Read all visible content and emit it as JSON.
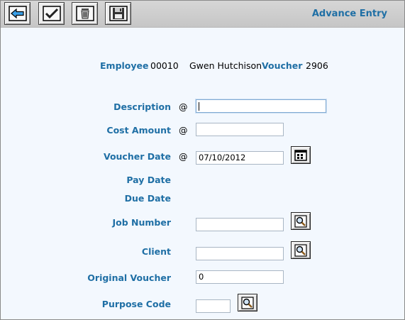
{
  "toolbar": {
    "back_icon": "back-arrow-icon",
    "confirm_icon": "checkmark-icon",
    "delete_icon": "trash-icon",
    "save_icon": "floppy-disk-icon"
  },
  "form_title": "Advance Entry",
  "employee": {
    "label": "Employee",
    "id": "00010",
    "name": "Gwen Hutchison"
  },
  "voucher": {
    "label": "Voucher",
    "number": "2906"
  },
  "required_marker": "@",
  "fields": {
    "description": {
      "label": "Description",
      "value": ""
    },
    "cost_amount": {
      "label": "Cost Amount",
      "value": ""
    },
    "voucher_date": {
      "label": "Voucher Date",
      "value": "07/10/2012"
    },
    "pay_date": {
      "label": "Pay Date"
    },
    "due_date": {
      "label": "Due Date"
    },
    "job_number": {
      "label": "Job Number",
      "value": ""
    },
    "client": {
      "label": "Client",
      "value": ""
    },
    "original_voucher": {
      "label": "Original Voucher",
      "value": "0"
    },
    "purpose_code": {
      "label": "Purpose Code",
      "value": ""
    }
  },
  "colors": {
    "label": "#1f6fa5",
    "background": "#f3f8fe",
    "toolbar": "#cfcfcf"
  }
}
